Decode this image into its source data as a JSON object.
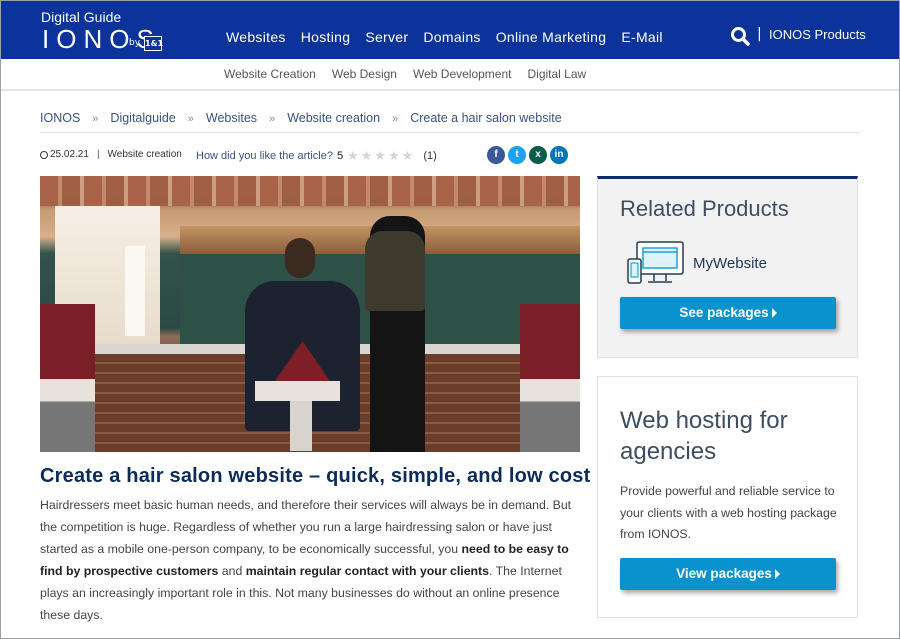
{
  "header": {
    "logo_subtitle": "Digital Guide",
    "logo_brand": "IONOS",
    "logo_by": "by",
    "logo_badge": "1&1",
    "nav": [
      "Websites",
      "Hosting",
      "Server",
      "Domains",
      "Online Marketing",
      "E-Mail"
    ],
    "separator": "|",
    "products_label": "IONOS Products"
  },
  "subnav": [
    "Website Creation",
    "Web Design",
    "Web Development",
    "Digital Law"
  ],
  "breadcrumb": {
    "separator": "»",
    "items": [
      "IONOS",
      "Digitalguide",
      "Websites",
      "Website creation",
      "Create a hair salon website"
    ]
  },
  "meta": {
    "date": "25.02.21",
    "separator": "|",
    "category": "Website creation",
    "rating_question": "How did you like the article?",
    "rating_value": "5",
    "stars_total": 5,
    "star_glyph": "★",
    "rating_count": "(1)"
  },
  "social": [
    {
      "name": "facebook",
      "glyph": "f",
      "color": "#3b5998"
    },
    {
      "name": "twitter",
      "glyph": "t",
      "color": "#1da1f2"
    },
    {
      "name": "xing",
      "glyph": "x",
      "color": "#0b5c4e"
    },
    {
      "name": "linkedin",
      "glyph": "in",
      "color": "#0077b5"
    }
  ],
  "article": {
    "image_alt": "Barber cutting a customer's hair in a brick-walled salon",
    "title": "Create a hair salon website – quick, simple, and low cost",
    "body_1": "Hairdressers meet basic human needs, and therefore their services will always be in demand. But the competition is huge. Regardless of whether you run a large hairdressing salon or have just started as a mobile one-person company, to be economically successful, you ",
    "body_bold_1": "need to be easy to find by prospective customers",
    "body_2": " and ",
    "body_bold_2": "maintain regular contact with your clients",
    "body_3": ". The Internet plays an increasingly important role in this. Not many businesses do without an online presence these days."
  },
  "sidebar": {
    "related": {
      "title": "Related Products",
      "product": "MyWebsite",
      "button": "See packages"
    },
    "promo": {
      "title": "Web hosting for agencies",
      "text": "Provide powerful and reliable service to your clients with a web hosting package from IONOS.",
      "button": "View packages"
    }
  },
  "colors": {
    "brand_blue": "#0b3399",
    "button_blue": "#0a92cf",
    "heading_navy": "#0b2c5a"
  }
}
